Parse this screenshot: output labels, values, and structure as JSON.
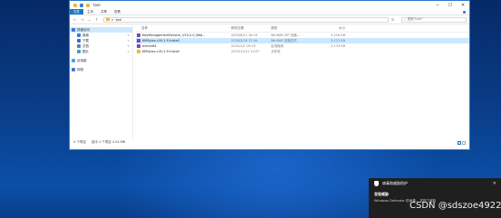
{
  "window": {
    "title": "tool",
    "controls": {
      "minimize": "─",
      "maximize": "☐",
      "close": "✕"
    },
    "ribbon_tabs": [
      "文件",
      "主页",
      "共享",
      "查看"
    ]
  },
  "address": {
    "path_sep": ">",
    "path": "tool",
    "search_placeholder": "搜索\"tool\""
  },
  "nav": {
    "quick_access": "快速访问",
    "items": [
      {
        "label": "桌面",
        "pinned": true,
        "color": "#3a7bd5"
      },
      {
        "label": "下载",
        "pinned": true,
        "color": "#2f6fd0"
      },
      {
        "label": "文档",
        "pinned": true,
        "color": "#6b7c93"
      },
      {
        "label": "图片",
        "pinned": true,
        "color": "#3aa0d8"
      }
    ],
    "this_pc": "此电脑",
    "network": "网络"
  },
  "columns": {
    "name": "名称",
    "date": "修改日期",
    "type": "类型",
    "size": "大小"
  },
  "files": [
    {
      "name": "KeyManagementService_V10.2.0_Wat...",
      "date": "2020/6/12 18:10",
      "type": "WinRAR ZIP 压缩...",
      "size": "5,216 KB",
      "selected": false,
      "icon_color": "#7a4bb5"
    },
    {
      "name": "KMSpico v10.1.9 Install",
      "date": "2016/5/26 17:44",
      "type": "WinRAR 压缩文件",
      "size": "3,121 KB",
      "selected": true,
      "icon_color": "#7a4bb5"
    },
    {
      "name": "winrar64",
      "date": "2022/2/1 19:03",
      "type": "应用程序",
      "size": "2,133 KB",
      "selected": false,
      "icon_color": "#7a4bb5"
    },
    {
      "name": "KMSpico v10.1.9 Install",
      "date": "2015/12/31 15:07",
      "type": "文件夹",
      "size": "",
      "selected": false,
      "icon_color": "#e8b84a"
    }
  ],
  "status": {
    "count": "4 个项目",
    "selected": "选中 1 个项目  3.04 MB"
  },
  "toast": {
    "header": "病毒和威胁防护",
    "title": "发现威胁",
    "body": "Windows Defender 防病毒... 发现了威胁",
    "close": "✕"
  },
  "watermark": "CSDN @sdszoe4922"
}
